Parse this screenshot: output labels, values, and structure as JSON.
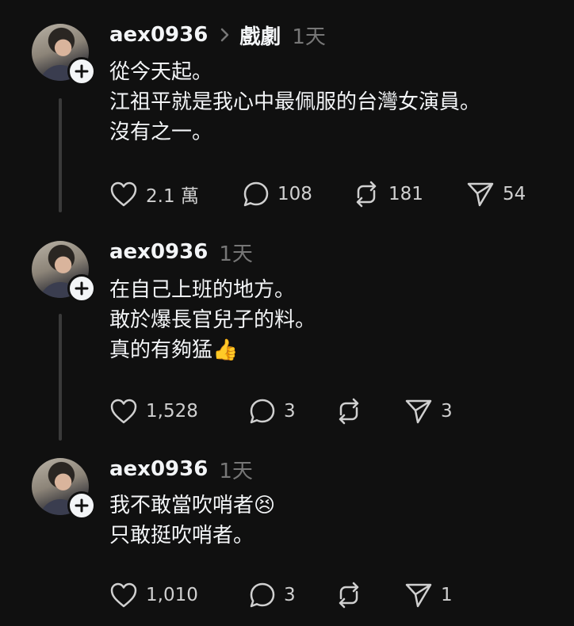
{
  "posts": [
    {
      "username": "aex0936",
      "topic": "戲劇",
      "time": "1天",
      "lines": [
        "從今天起。",
        "江祖平就是我心中最佩服的台灣女演員。",
        "沒有之一。"
      ],
      "likes": "2.1 萬",
      "comments": "108",
      "reposts": "181",
      "shares": "54"
    },
    {
      "username": "aex0936",
      "time": "1天",
      "lines": [
        "在自己上班的地方。",
        "敢於爆長官兒子的料。",
        "真的有夠猛👍"
      ],
      "likes": "1,528",
      "comments": "3",
      "reposts": "",
      "shares": "3"
    },
    {
      "username": "aex0936",
      "time": "1天",
      "lines": [
        "我不敢當吹哨者😣",
        "只敢挺吹哨者。"
      ],
      "likes": "1,010",
      "comments": "3",
      "reposts": "",
      "shares": "1"
    }
  ],
  "icons": {
    "avatar_follow": "plus-icon",
    "topic_separator": "chevron-right-icon",
    "like": "heart-icon",
    "comment": "comment-bubble-icon",
    "repost": "repost-icon",
    "share": "send-icon"
  },
  "colors": {
    "background": "#101010",
    "text": "#f3f5f7",
    "muted": "#777777"
  }
}
